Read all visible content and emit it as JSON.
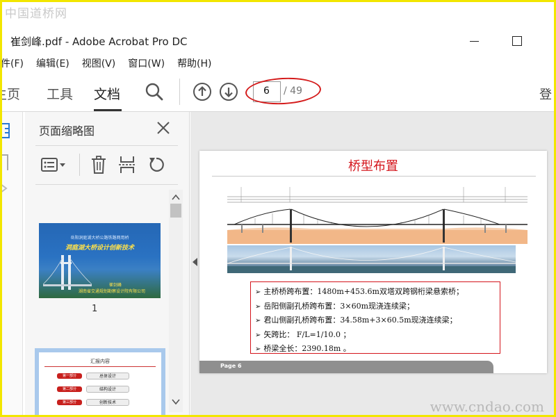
{
  "watermarks": {
    "top": "中国道桥网",
    "bottom": "www.cndao.com"
  },
  "window": {
    "title": "崔剑峰.pdf - Adobe Acrobat Pro DC"
  },
  "menu": {
    "items": [
      "件(F)",
      "编辑(E)",
      "视图(V)",
      "窗口(W)",
      "帮助(H)"
    ]
  },
  "toolbar": {
    "tabs": {
      "home": "主页",
      "tools": "工具",
      "document": "文档"
    },
    "page_current": "6",
    "page_total": "/ 49",
    "login": "登"
  },
  "sidebar": {
    "title": "页面缩略图",
    "thumbnails": [
      {
        "number": "1",
        "line1": "岳阳洞庭湖大桥公路铁路两用桥",
        "line2": "洞庭湖大桥设计创新技术",
        "author": "崔剑峰",
        "org": "湖南省交通规划勘察设计院有限公司"
      },
      {
        "title": "汇报内容",
        "items": [
          {
            "part": "第一部分",
            "label": "总体设计"
          },
          {
            "part": "第二部分",
            "label": "结构设计"
          },
          {
            "part": "第三部分",
            "label": "创新技术"
          }
        ]
      }
    ]
  },
  "slide": {
    "title": "桥型布置",
    "bullets": [
      "主桥桥跨布置：1480m+453.6m双塔双跨钢桁梁悬索桥；",
      "岳阳侧副孔桥跨布置：3×60m现浇连续梁；",
      "君山侧副孔桥跨布置：34.58m+3×60.5m现浇连续梁；",
      "矢跨比：    F/L=1/10.0 ；",
      "桥梁全长：2390.18m 。"
    ],
    "footer": "Page 6"
  },
  "colors": {
    "accent_red": "#d4141b",
    "frame_yellow": "#f2e600"
  }
}
